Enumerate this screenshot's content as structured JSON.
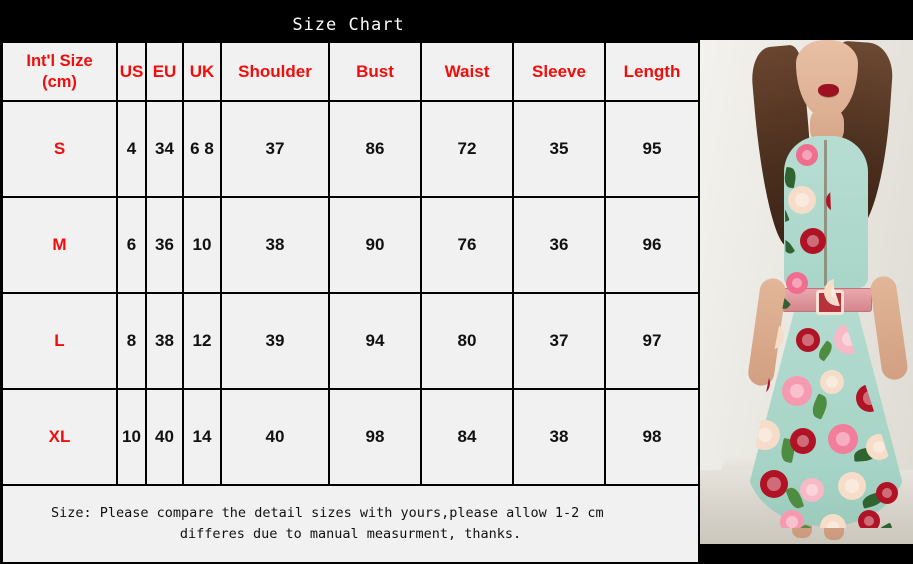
{
  "title": "Size Chart",
  "table": {
    "headers": [
      "Int'l Size (cm)",
      "US",
      "EU",
      "UK",
      "Shoulder",
      "Bust",
      "Waist",
      "Sleeve",
      "Length"
    ],
    "header_intl_line1": "Int'l Size",
    "header_intl_line2": "(cm)",
    "rows": [
      {
        "size": "S",
        "us": "4",
        "eu": "34",
        "uk": "6 8",
        "shoulder": "37",
        "bust": "86",
        "waist": "72",
        "sleeve": "35",
        "length": "95"
      },
      {
        "size": "M",
        "us": "6",
        "eu": "36",
        "uk": "10",
        "shoulder": "38",
        "bust": "90",
        "waist": "76",
        "sleeve": "36",
        "length": "96"
      },
      {
        "size": "L",
        "us": "8",
        "eu": "38",
        "uk": "12",
        "shoulder": "39",
        "bust": "94",
        "waist": "80",
        "sleeve": "37",
        "length": "97"
      },
      {
        "size": "XL",
        "us": "10",
        "eu": "40",
        "uk": "14",
        "shoulder": "40",
        "bust": "98",
        "waist": "84",
        "sleeve": "38",
        "length": "98"
      }
    ],
    "note_line1": "Size: Please compare the detail sizes with yours,please allow 1-2 cm",
    "note_line2": "differes due to manual measurment,  thanks."
  },
  "photo": {
    "alt": "woman-wearing-floral-rose-print-midi-dress"
  },
  "colors": {
    "background": "#000000",
    "cell_background": "#f1f1f1",
    "accent_red": "#f20d0d",
    "value_text": "#111111",
    "title_text": "#ffffff",
    "border": "#000000"
  }
}
